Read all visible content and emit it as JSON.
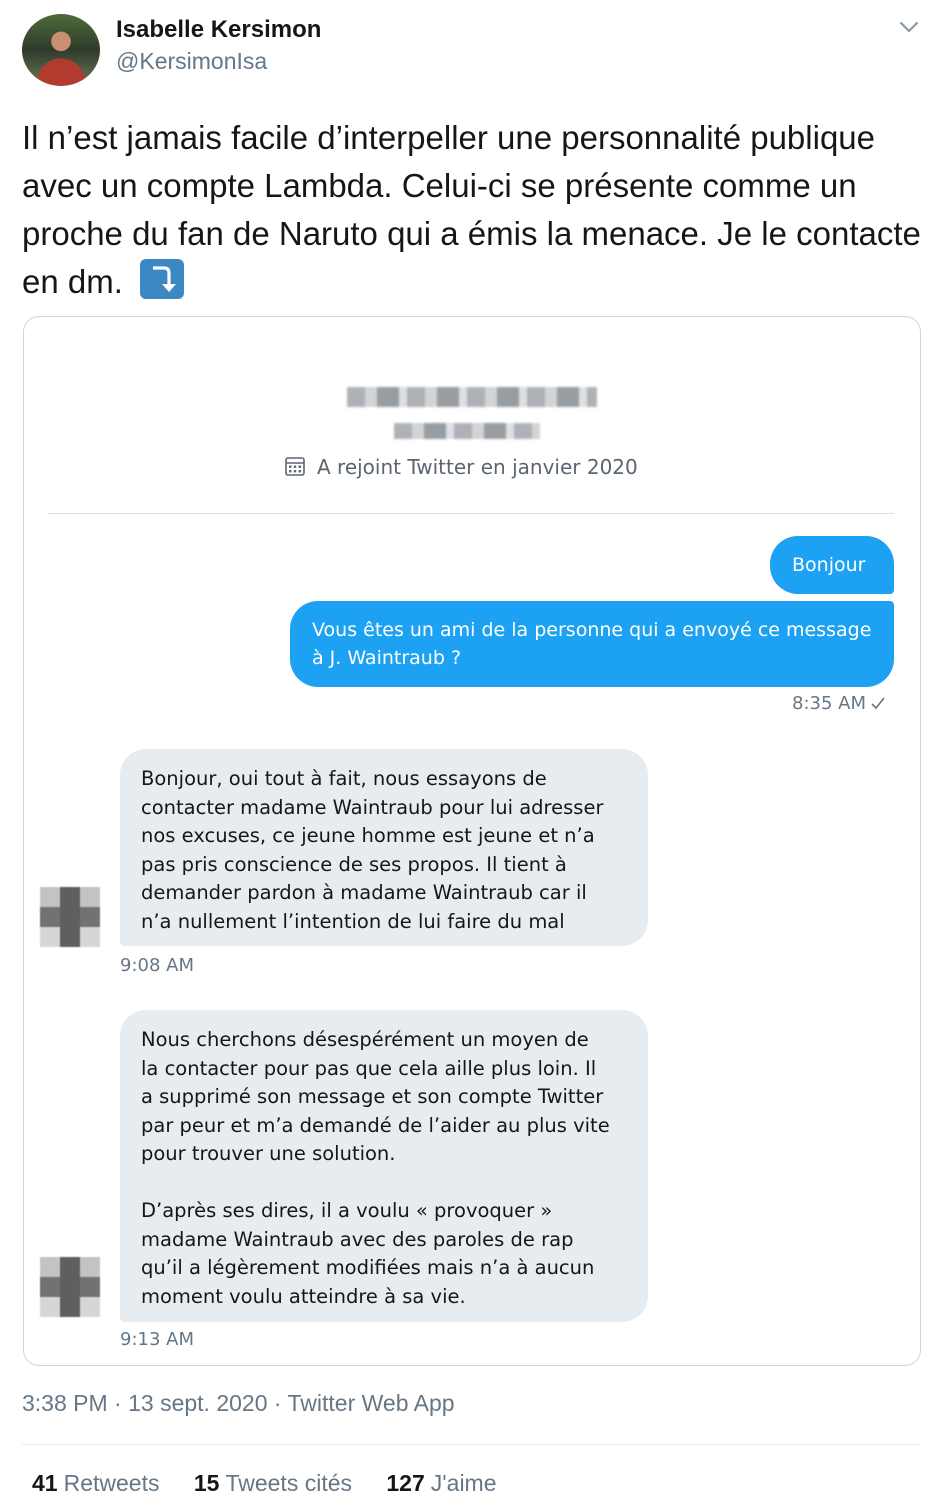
{
  "author": {
    "name": "Isabelle Kersimon",
    "handle": "@KersimonIsa"
  },
  "tweet": {
    "text": "Il n’est jamais facile d’interpeller une personnalité publique avec un compte Lambda. Celui-ci se présente comme un proche du fan de Naruto qui a émis la menace. Je le contacte en dm. ",
    "emoji": "right-arrow-curving-down-icon"
  },
  "screenshot": {
    "joined": "A rejoint Twitter en janvier 2020",
    "messages_out": [
      "Bonjour",
      "Vous êtes un ami de la personne qui a envoyé ce message à J. Waintraub ?"
    ],
    "out_time": "8:35 AM",
    "messages_in": [
      {
        "text": "Bonjour, oui tout à fait, nous essayons de\ncontacter madame Waintraub pour lui adresser\nnos excuses, ce jeune homme est jeune et n’a\npas pris conscience de ses propos. Il tient à\ndemander pardon à madame Waintraub car il\nn’a nullement l’intention de lui faire du mal",
        "time": "9:08 AM"
      },
      {
        "text": "Nous cherchons désespérément un moyen de\nla contacter pour pas que cela aille plus loin. Il\na supprimé son message et son compte Twitter\npar peur et m’a demandé de l’aider au plus vite\npour trouver une solution.\n\nD’après ses dires, il a voulu « provoquer »\nmadame Waintraub avec des paroles de rap\nqu’il a légèrement modifiées mais n’a à aucun\nmoment voulu atteindre à sa vie.",
        "time": "9:13 AM"
      }
    ]
  },
  "meta": {
    "line": "3:38 PM · 13 sept. 2020 · Twitter Web App"
  },
  "stats": {
    "retweets_count": "41",
    "retweets_label": "Retweets",
    "quotes_count": "15",
    "quotes_label": "Tweets cités",
    "likes_count": "127",
    "likes_label": "J'aime"
  },
  "colors": {
    "accent": "#1da1f2",
    "incoming_bubble": "#e6ecf0",
    "secondary_text": "#657786"
  }
}
